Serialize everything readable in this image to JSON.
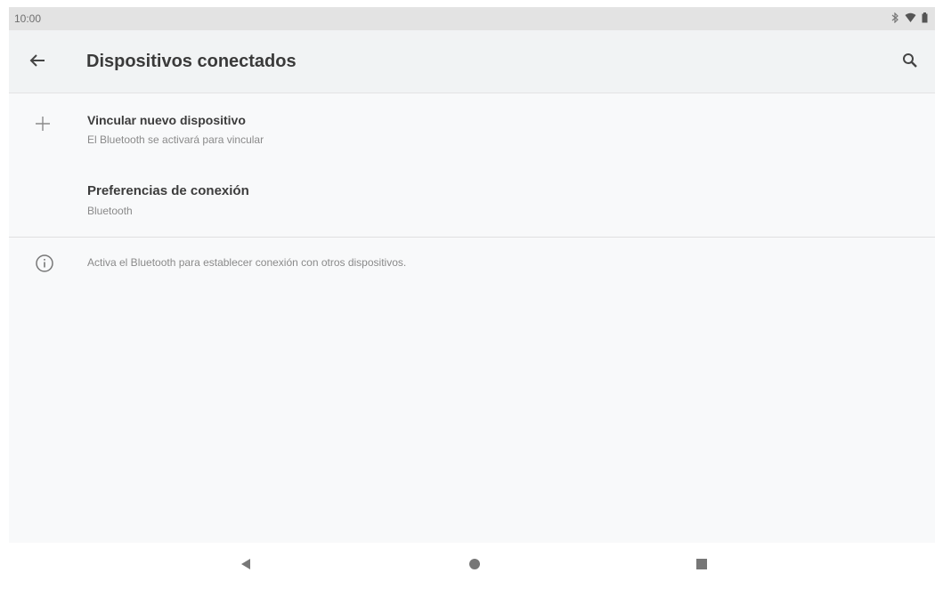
{
  "status_bar": {
    "time": "10:00",
    "icons": [
      "bluetooth-icon",
      "wifi-icon",
      "battery-icon"
    ]
  },
  "app_bar": {
    "back_icon": "arrow-back-icon",
    "title": "Dispositivos conectados",
    "search_icon": "search-icon"
  },
  "list": {
    "items": [
      {
        "icon": "plus-icon",
        "title": "Vincular nuevo dispositivo",
        "subtitle": "El Bluetooth se activará para vincular"
      },
      {
        "icon": "",
        "title": "Preferencias de conexión",
        "subtitle": "Bluetooth"
      }
    ]
  },
  "info": {
    "icon": "info-icon",
    "text": "Activa el Bluetooth para establecer conexión con otros dispositivos."
  },
  "nav_bar": {
    "buttons": [
      "back-triangle-icon",
      "home-circle-icon",
      "recents-square-icon"
    ]
  },
  "colors": {
    "status_bar_bg": "#e3e3e3",
    "app_bar_bg": "#f1f3f4",
    "screen_bg": "#f8f9fa",
    "secondary_text": "#8a8a8a"
  }
}
